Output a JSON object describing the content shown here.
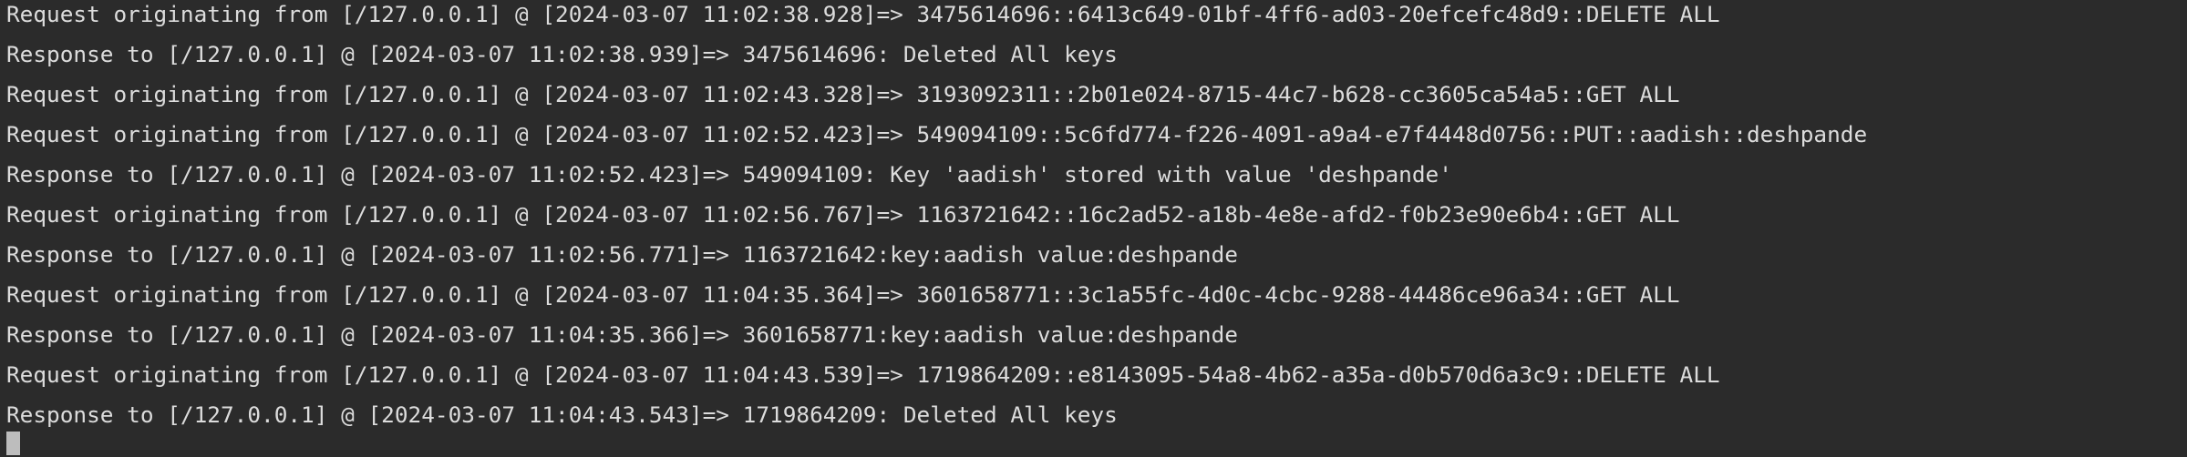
{
  "console": {
    "lines": [
      "Request originating from [/127.0.0.1] @ [2024-03-07 11:02:38.928]=> 3475614696::6413c649-01bf-4ff6-ad03-20efcefc48d9::DELETE ALL",
      "Response to [/127.0.0.1] @ [2024-03-07 11:02:38.939]=> 3475614696: Deleted All keys",
      "Request originating from [/127.0.0.1] @ [2024-03-07 11:02:43.328]=> 3193092311::2b01e024-8715-44c7-b628-cc3605ca54a5::GET ALL",
      "Request originating from [/127.0.0.1] @ [2024-03-07 11:02:52.423]=> 549094109::5c6fd774-f226-4091-a9a4-e7f4448d0756::PUT::aadish::deshpande",
      "Response to [/127.0.0.1] @ [2024-03-07 11:02:52.423]=> 549094109: Key 'aadish' stored with value 'deshpande'",
      "Request originating from [/127.0.0.1] @ [2024-03-07 11:02:56.767]=> 1163721642::16c2ad52-a18b-4e8e-afd2-f0b23e90e6b4::GET ALL",
      "Response to [/127.0.0.1] @ [2024-03-07 11:02:56.771]=> 1163721642:key:aadish value:deshpande",
      "Request originating from [/127.0.0.1] @ [2024-03-07 11:04:35.364]=> 3601658771::3c1a55fc-4d0c-4cbc-9288-44486ce96a34::GET ALL",
      "Response to [/127.0.0.1] @ [2024-03-07 11:04:35.366]=> 3601658771:key:aadish value:deshpande",
      "Request originating from [/127.0.0.1] @ [2024-03-07 11:04:43.539]=> 1719864209::e8143095-54a8-4b62-a35a-d0b570d6a3c9::DELETE ALL",
      "Response to [/127.0.0.1] @ [2024-03-07 11:04:43.543]=> 1719864209: Deleted All keys"
    ],
    "colors": {
      "background": "#2b2b2b",
      "text": "#dcdcdc",
      "cursor": "#bdbdbd"
    }
  }
}
